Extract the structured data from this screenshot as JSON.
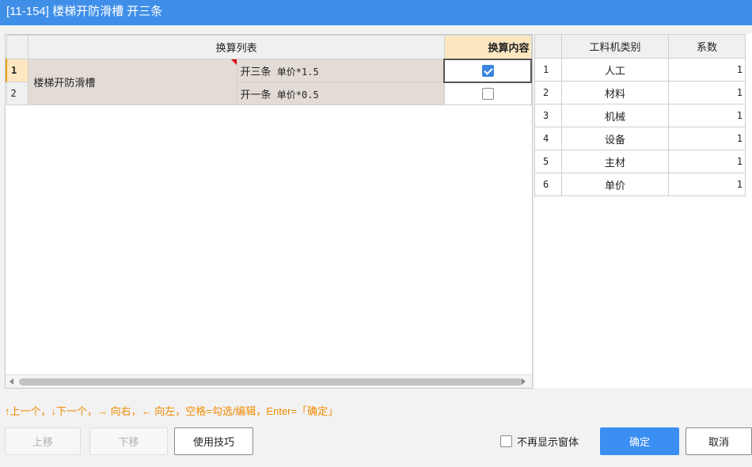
{
  "window": {
    "title": "[11-154] 楼梯开防滑槽 开三条"
  },
  "left_table": {
    "header_list": "换算列表",
    "header_content": "换算内容",
    "group_name": "楼梯开防滑槽",
    "rows": [
      {
        "num": "1",
        "content_cn": "开三条",
        "content_expr": " 单价*1.5",
        "checked": true
      },
      {
        "num": "2",
        "content_cn": "开一条",
        "content_expr": " 单价*0.5",
        "checked": false
      }
    ]
  },
  "right_table": {
    "header_category": "工料机类别",
    "header_coef": "系数",
    "rows": [
      {
        "num": "1",
        "category": "人工",
        "coef": "1"
      },
      {
        "num": "2",
        "category": "材料",
        "coef": "1"
      },
      {
        "num": "3",
        "category": "机械",
        "coef": "1"
      },
      {
        "num": "4",
        "category": "设备",
        "coef": "1"
      },
      {
        "num": "5",
        "category": "主材",
        "coef": "1"
      },
      {
        "num": "6",
        "category": "单价",
        "coef": "1"
      }
    ]
  },
  "hint": "↑上一个，↓下一个，→ 向右，← 向左，空格=勾选/编辑，Enter=「确定」",
  "buttons": {
    "move_up": "上移",
    "move_down": "下移",
    "tips": "使用技巧",
    "no_show": "不再显示窗体",
    "ok": "确定",
    "cancel": "取消"
  },
  "colors": {
    "titlebar": "#3f8fe9",
    "hint": "#f08a00",
    "primary": "#3b8ef2",
    "highlight_header": "#fde7c0",
    "row_fill": "#e3dcd6"
  }
}
